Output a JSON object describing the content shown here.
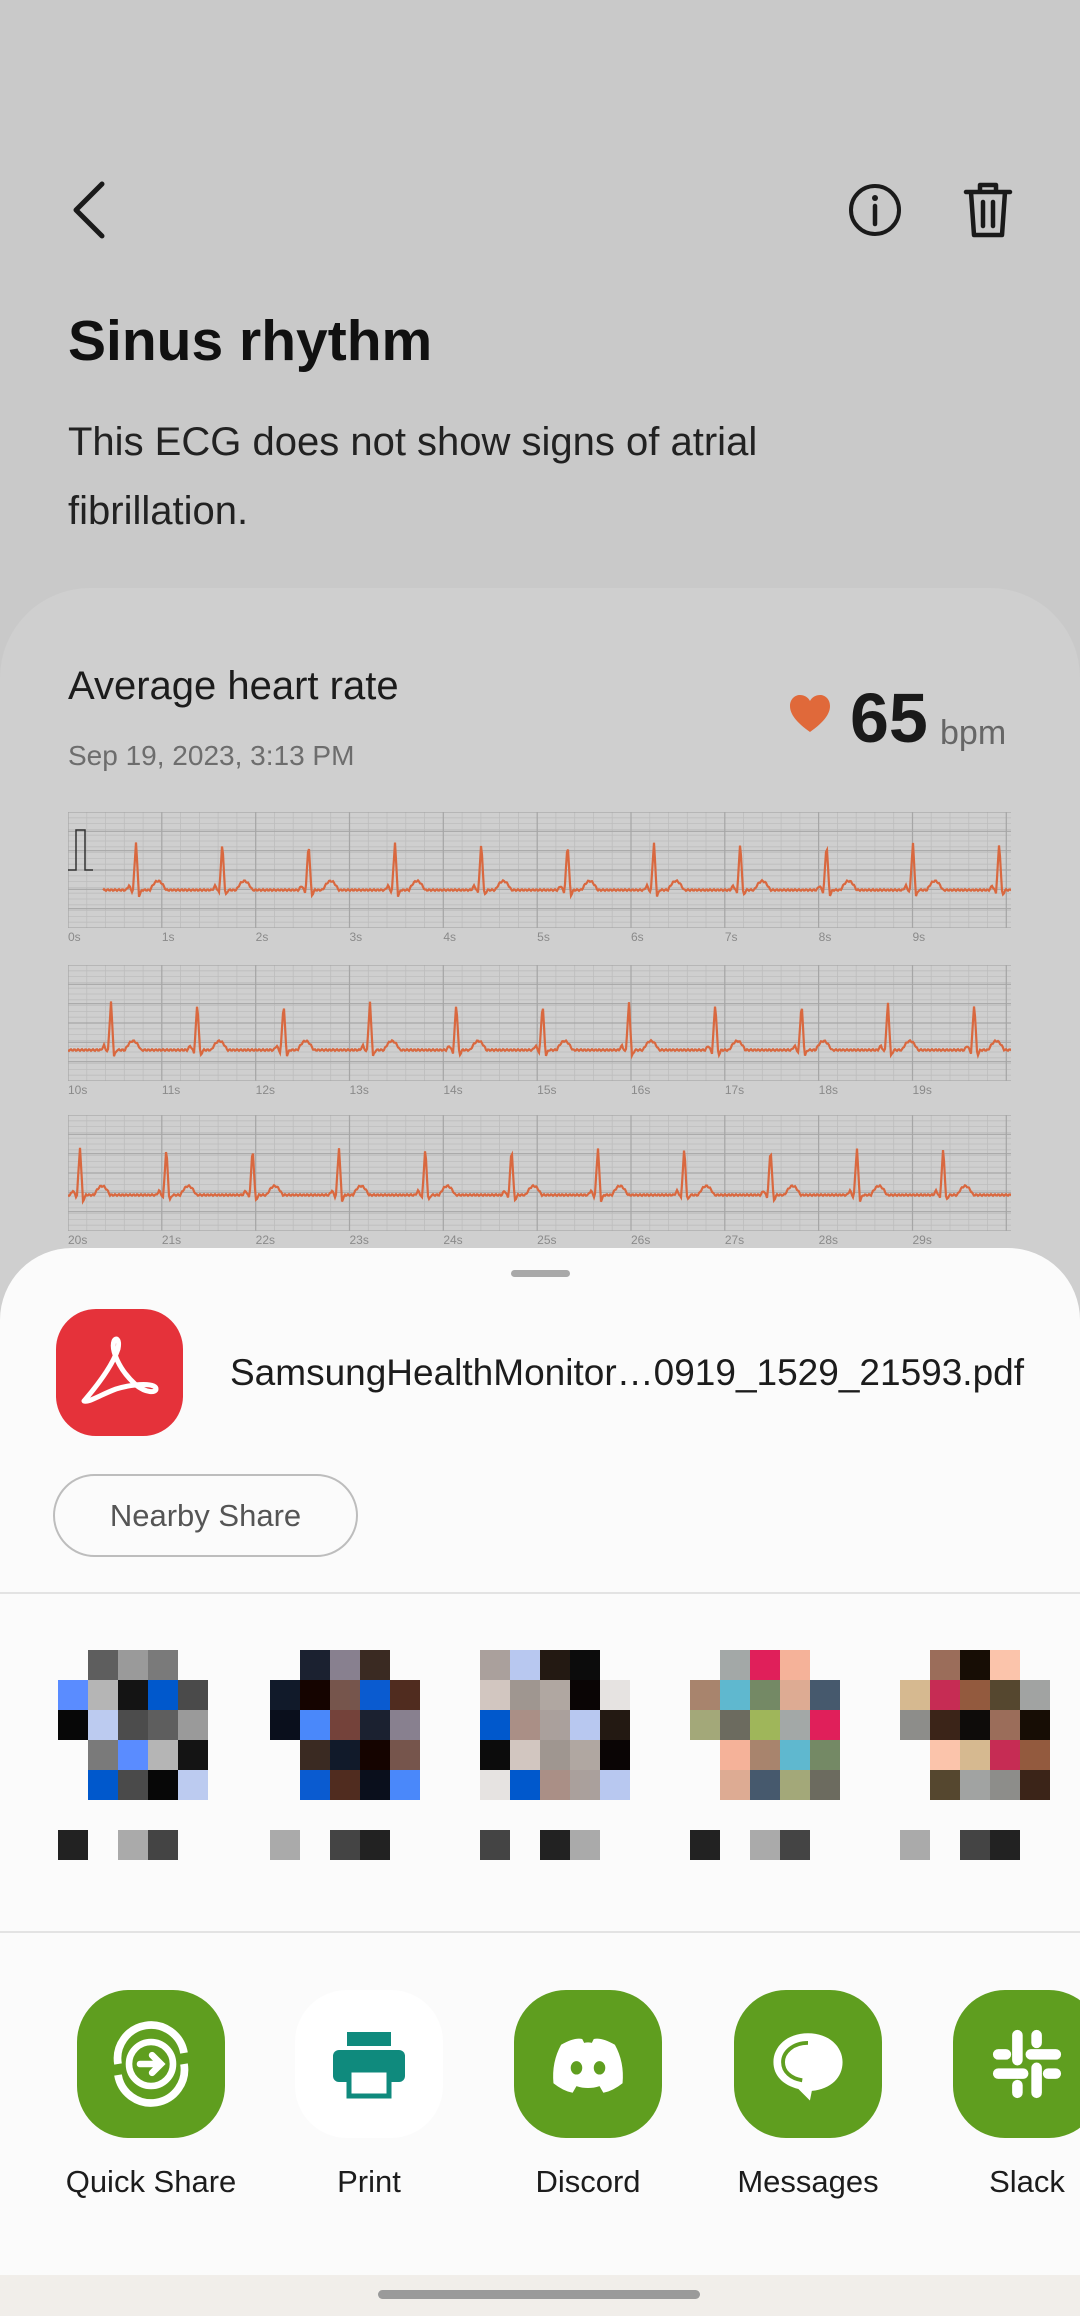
{
  "header": {
    "back_icon": "chevron-left-icon",
    "info_icon": "info-icon",
    "delete_icon": "trash-icon"
  },
  "result": {
    "title": "Sinus rhythm",
    "description": "This ECG does not show signs of atrial fibrillation."
  },
  "summary": {
    "label": "Average heart rate",
    "date": "Sep 19, 2023, 3:13 PM",
    "heart_rate": "65",
    "unit": "bpm",
    "heart_color": "#e0693a"
  },
  "ecg": {
    "trace_color": "#d9683f",
    "rows": [
      {
        "ticks": [
          "0s",
          "1s",
          "2s",
          "3s",
          "4s",
          "5s",
          "6s",
          "7s",
          "8s",
          "9s"
        ]
      },
      {
        "ticks": [
          "10s",
          "11s",
          "12s",
          "13s",
          "14s",
          "15s",
          "16s",
          "17s",
          "18s",
          "19s"
        ]
      },
      {
        "ticks": [
          "20s",
          "21s",
          "22s",
          "23s",
          "24s",
          "25s",
          "26s",
          "27s",
          "28s",
          "29s"
        ]
      }
    ]
  },
  "share_sheet": {
    "file_name": "SamsungHealthMonitor…0919_1529_21593.pdf",
    "file_icon": "adobe-acrobat-icon",
    "nearby_share": "Nearby Share",
    "apps": [
      {
        "label": "Quick Share",
        "icon": "quick-share-icon"
      },
      {
        "label": "Print",
        "icon": "printer-icon"
      },
      {
        "label": "Discord",
        "icon": "discord-icon"
      },
      {
        "label": "Messages",
        "icon": "messages-icon"
      },
      {
        "label": "Slack",
        "icon": "slack-icon"
      }
    ],
    "accent": "#5f9e1f"
  }
}
